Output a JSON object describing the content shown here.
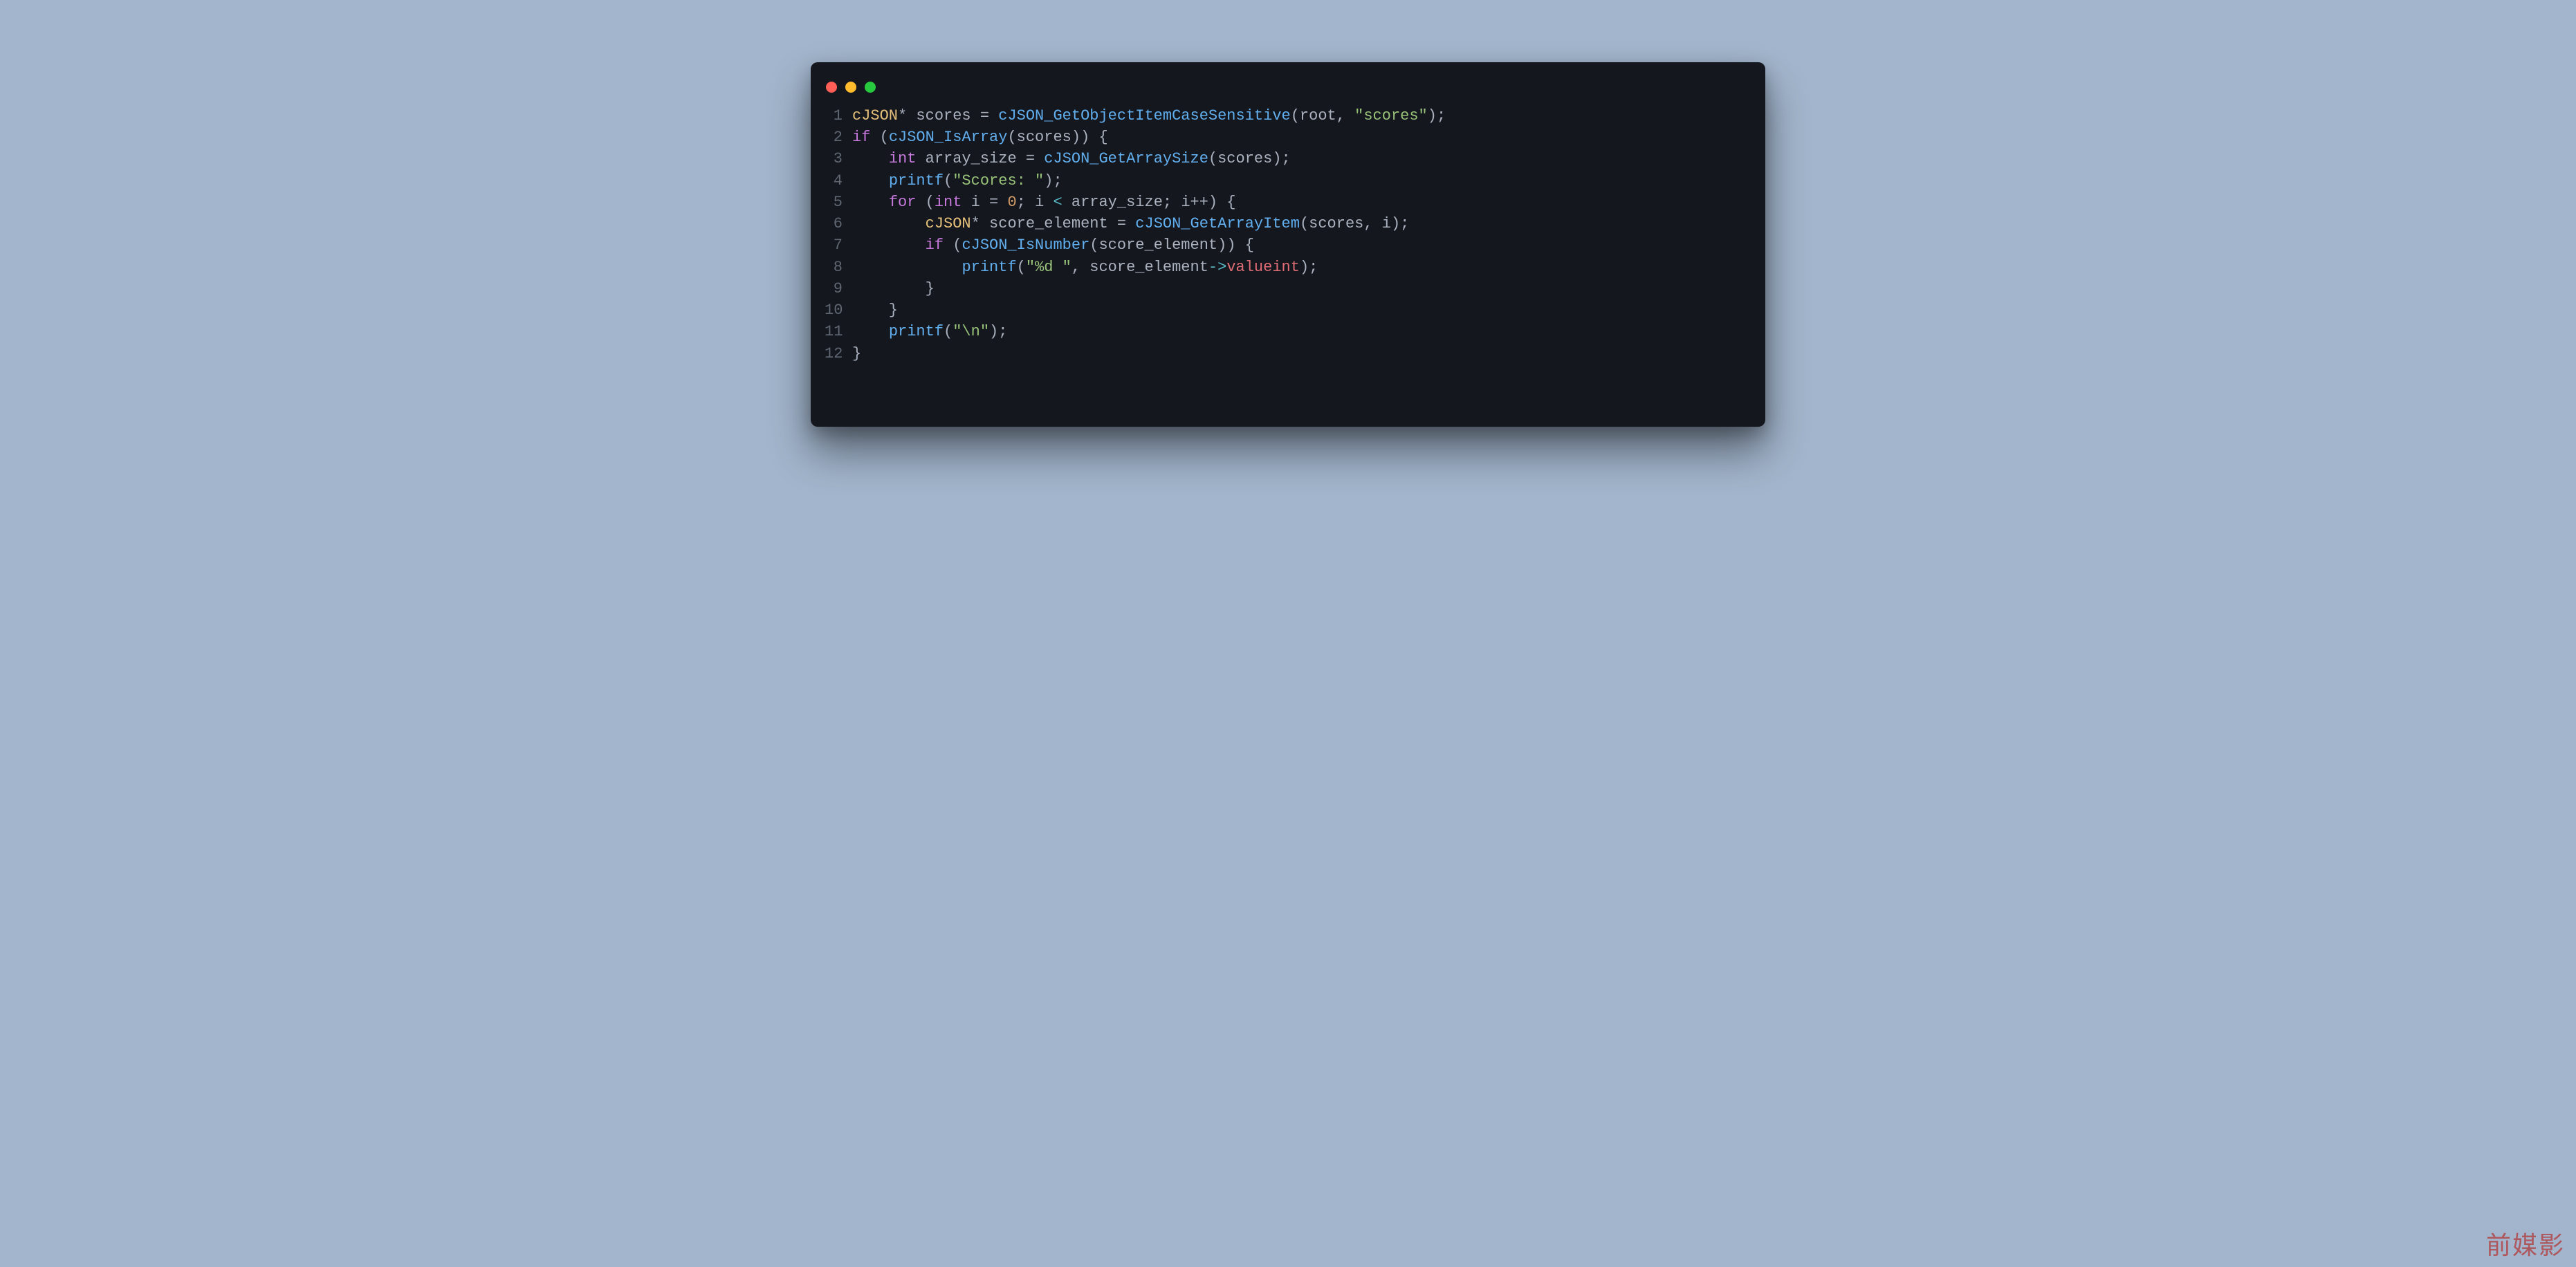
{
  "window": {
    "traffic_lights": [
      "close",
      "minimize",
      "zoom"
    ]
  },
  "code": {
    "language": "c",
    "lines": [
      {
        "n": 1,
        "tokens": [
          {
            "t": "cJSON",
            "c": "tok-type"
          },
          {
            "t": "* ",
            "c": "tok-punc"
          },
          {
            "t": "scores",
            "c": "tok-id"
          },
          {
            "t": " = ",
            "c": "tok-punc"
          },
          {
            "t": "cJSON_GetObjectItemCaseSensitive",
            "c": "tok-func"
          },
          {
            "t": "(",
            "c": "tok-punc"
          },
          {
            "t": "root",
            "c": "tok-id"
          },
          {
            "t": ", ",
            "c": "tok-punc"
          },
          {
            "t": "\"scores\"",
            "c": "tok-str"
          },
          {
            "t": ");",
            "c": "tok-punc"
          }
        ]
      },
      {
        "n": 2,
        "tokens": [
          {
            "t": "if",
            "c": "tok-key"
          },
          {
            "t": " (",
            "c": "tok-punc"
          },
          {
            "t": "cJSON_IsArray",
            "c": "tok-func"
          },
          {
            "t": "(",
            "c": "tok-punc"
          },
          {
            "t": "scores",
            "c": "tok-id"
          },
          {
            "t": ")) {",
            "c": "tok-punc"
          }
        ]
      },
      {
        "n": 3,
        "tokens": [
          {
            "t": "    ",
            "c": "tok"
          },
          {
            "t": "int",
            "c": "tok-key"
          },
          {
            "t": " ",
            "c": "tok"
          },
          {
            "t": "array_size",
            "c": "tok-id"
          },
          {
            "t": " = ",
            "c": "tok-punc"
          },
          {
            "t": "cJSON_GetArraySize",
            "c": "tok-func"
          },
          {
            "t": "(",
            "c": "tok-punc"
          },
          {
            "t": "scores",
            "c": "tok-id"
          },
          {
            "t": ");",
            "c": "tok-punc"
          }
        ]
      },
      {
        "n": 4,
        "tokens": [
          {
            "t": "    ",
            "c": "tok"
          },
          {
            "t": "printf",
            "c": "tok-func"
          },
          {
            "t": "(",
            "c": "tok-punc"
          },
          {
            "t": "\"Scores: \"",
            "c": "tok-str"
          },
          {
            "t": ");",
            "c": "tok-punc"
          }
        ]
      },
      {
        "n": 5,
        "tokens": [
          {
            "t": "    ",
            "c": "tok"
          },
          {
            "t": "for",
            "c": "tok-key"
          },
          {
            "t": " (",
            "c": "tok-punc"
          },
          {
            "t": "int",
            "c": "tok-key"
          },
          {
            "t": " ",
            "c": "tok"
          },
          {
            "t": "i",
            "c": "tok-id"
          },
          {
            "t": " = ",
            "c": "tok-punc"
          },
          {
            "t": "0",
            "c": "tok-num"
          },
          {
            "t": "; ",
            "c": "tok-punc"
          },
          {
            "t": "i",
            "c": "tok-id"
          },
          {
            "t": " < ",
            "c": "tok-op"
          },
          {
            "t": "array_size",
            "c": "tok-id"
          },
          {
            "t": "; ",
            "c": "tok-punc"
          },
          {
            "t": "i",
            "c": "tok-id"
          },
          {
            "t": "++) {",
            "c": "tok-punc"
          }
        ]
      },
      {
        "n": 6,
        "tokens": [
          {
            "t": "        ",
            "c": "tok"
          },
          {
            "t": "cJSON",
            "c": "tok-type"
          },
          {
            "t": "* ",
            "c": "tok-punc"
          },
          {
            "t": "score_element",
            "c": "tok-id"
          },
          {
            "t": " = ",
            "c": "tok-punc"
          },
          {
            "t": "cJSON_GetArrayItem",
            "c": "tok-func"
          },
          {
            "t": "(",
            "c": "tok-punc"
          },
          {
            "t": "scores",
            "c": "tok-id"
          },
          {
            "t": ", ",
            "c": "tok-punc"
          },
          {
            "t": "i",
            "c": "tok-id"
          },
          {
            "t": ");",
            "c": "tok-punc"
          }
        ]
      },
      {
        "n": 7,
        "tokens": [
          {
            "t": "        ",
            "c": "tok"
          },
          {
            "t": "if",
            "c": "tok-key"
          },
          {
            "t": " (",
            "c": "tok-punc"
          },
          {
            "t": "cJSON_IsNumber",
            "c": "tok-func"
          },
          {
            "t": "(",
            "c": "tok-punc"
          },
          {
            "t": "score_element",
            "c": "tok-id"
          },
          {
            "t": ")) {",
            "c": "tok-punc"
          }
        ]
      },
      {
        "n": 8,
        "tokens": [
          {
            "t": "            ",
            "c": "tok"
          },
          {
            "t": "printf",
            "c": "tok-func"
          },
          {
            "t": "(",
            "c": "tok-punc"
          },
          {
            "t": "\"%d \"",
            "c": "tok-str"
          },
          {
            "t": ", ",
            "c": "tok-punc"
          },
          {
            "t": "score_element",
            "c": "tok-id"
          },
          {
            "t": "->",
            "c": "tok-op"
          },
          {
            "t": "valueint",
            "c": "tok-var"
          },
          {
            "t": ");",
            "c": "tok-punc"
          }
        ]
      },
      {
        "n": 9,
        "tokens": [
          {
            "t": "        }",
            "c": "tok-punc"
          }
        ]
      },
      {
        "n": 10,
        "tokens": [
          {
            "t": "    }",
            "c": "tok-punc"
          }
        ]
      },
      {
        "n": 11,
        "tokens": [
          {
            "t": "    ",
            "c": "tok"
          },
          {
            "t": "printf",
            "c": "tok-func"
          },
          {
            "t": "(",
            "c": "tok-punc"
          },
          {
            "t": "\"\\n\"",
            "c": "tok-str"
          },
          {
            "t": ");",
            "c": "tok-punc"
          }
        ]
      },
      {
        "n": 12,
        "tokens": [
          {
            "t": "}",
            "c": "tok-punc"
          }
        ]
      }
    ]
  },
  "watermark": "前媒影"
}
